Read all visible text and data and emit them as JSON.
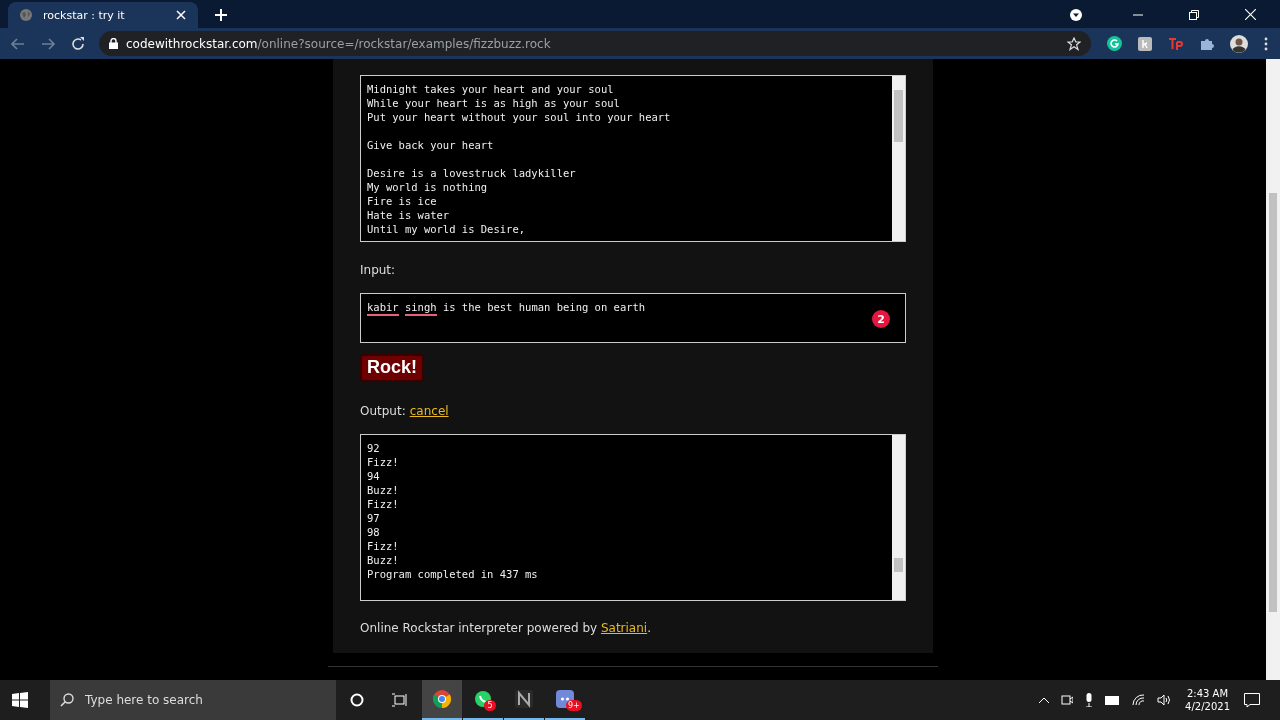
{
  "browser": {
    "tabs": [
      {
        "title": "rockstar : try it",
        "selected": true
      }
    ],
    "url_host": "codewithrockstar.com",
    "url_path": "/online?source=/rockstar/examples/fizzbuzz.rock"
  },
  "code_editor": {
    "stanzas": [
      [
        "Midnight takes your heart and your soul",
        "While your heart is as high as your soul",
        "Put your heart without your soul into your heart"
      ],
      [
        "Give back your heart"
      ],
      [
        "Desire is a lovestruck ladykiller",
        "My world is nothing",
        "Fire is ice",
        "Hate is water",
        "Until my world is Desire,"
      ]
    ]
  },
  "input": {
    "label": "Input:",
    "words": [
      {
        "text": "kabir",
        "misspelled": true
      },
      {
        "text": "singh",
        "misspelled": true
      },
      {
        "text": "is the best human being on earth",
        "misspelled": false
      }
    ],
    "badge": "2"
  },
  "rock_button": "Rock!",
  "output": {
    "label": "Output:",
    "cancel_link": "cancel",
    "lines": [
      "92",
      "Fizz!",
      "94",
      "Buzz!",
      "Fizz!",
      "97",
      "98",
      "Fizz!",
      "Buzz!",
      "Program completed in 437 ms"
    ]
  },
  "footer": {
    "text": "Online Rockstar interpreter powered by ",
    "link": "Satriani",
    "after": "."
  },
  "taskbar": {
    "search_placeholder": "Type here to search",
    "apps": [
      {
        "kind": "chrome",
        "selected": true
      },
      {
        "kind": "whatsapp",
        "badge": "5",
        "selected": false
      },
      {
        "kind": "notion",
        "selected": false
      },
      {
        "kind": "discord",
        "badge": "9+",
        "selected": false
      }
    ],
    "time": "2:43 AM",
    "date": "4/2/2021"
  }
}
